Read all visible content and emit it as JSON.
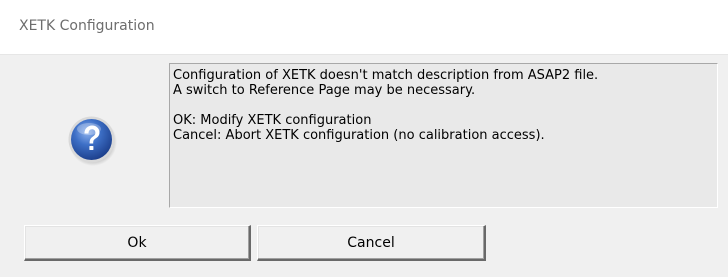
{
  "window": {
    "title": "XETK Configuration"
  },
  "message": {
    "icon": "question-icon",
    "lines": [
      "Configuration of XETK doesn't match description from ASAP2 file.",
      "A switch to Reference Page may be necessary.",
      "",
      "OK: Modify XETK configuration",
      "Cancel: Abort XETK configuration (no calibration access)."
    ]
  },
  "buttons": {
    "ok_label": "Ok",
    "cancel_label": "Cancel"
  },
  "colors": {
    "icon_blue": "#2f5fb8",
    "dialog_bg": "#f0f0f0",
    "message_bg": "#e9e9e9"
  }
}
